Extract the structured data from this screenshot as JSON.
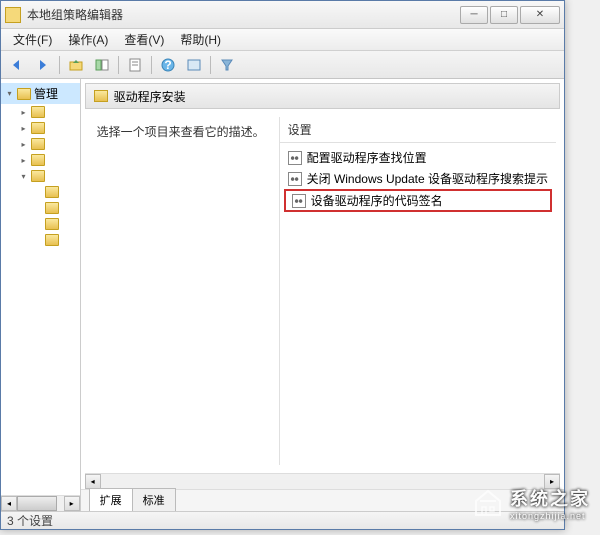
{
  "window": {
    "title": "本地组策略编辑器"
  },
  "menu": {
    "file": "文件(F)",
    "action": "操作(A)",
    "view": "查看(V)",
    "help": "帮助(H)"
  },
  "tree": {
    "items": [
      {
        "label": "管理",
        "expand": "▾",
        "indent": 0,
        "selected": true
      },
      {
        "label": "",
        "expand": "▸",
        "indent": 1
      },
      {
        "label": "",
        "expand": "▸",
        "indent": 1
      },
      {
        "label": "",
        "expand": "▸",
        "indent": 1
      },
      {
        "label": "",
        "expand": "▸",
        "indent": 1
      },
      {
        "label": "",
        "expand": "▾",
        "indent": 1
      },
      {
        "label": "",
        "expand": "",
        "indent": 2
      },
      {
        "label": "",
        "expand": "",
        "indent": 2
      },
      {
        "label": "",
        "expand": "",
        "indent": 2
      },
      {
        "label": "",
        "expand": "",
        "indent": 2
      }
    ]
  },
  "main": {
    "header": "驱动程序安装",
    "description": "选择一个项目来查看它的描述。",
    "settings_header": "设置",
    "settings": [
      {
        "label": "配置驱动程序查找位置",
        "highlight": false
      },
      {
        "label": "关闭 Windows Update 设备驱动程序搜索提示",
        "highlight": false
      },
      {
        "label": "设备驱动程序的代码签名",
        "highlight": true
      }
    ],
    "tabs": {
      "extended": "扩展",
      "standard": "标准"
    }
  },
  "status": {
    "text": "3 个设置"
  },
  "watermark": {
    "main": "系统之家",
    "sub": "xitongzhijia.net"
  }
}
